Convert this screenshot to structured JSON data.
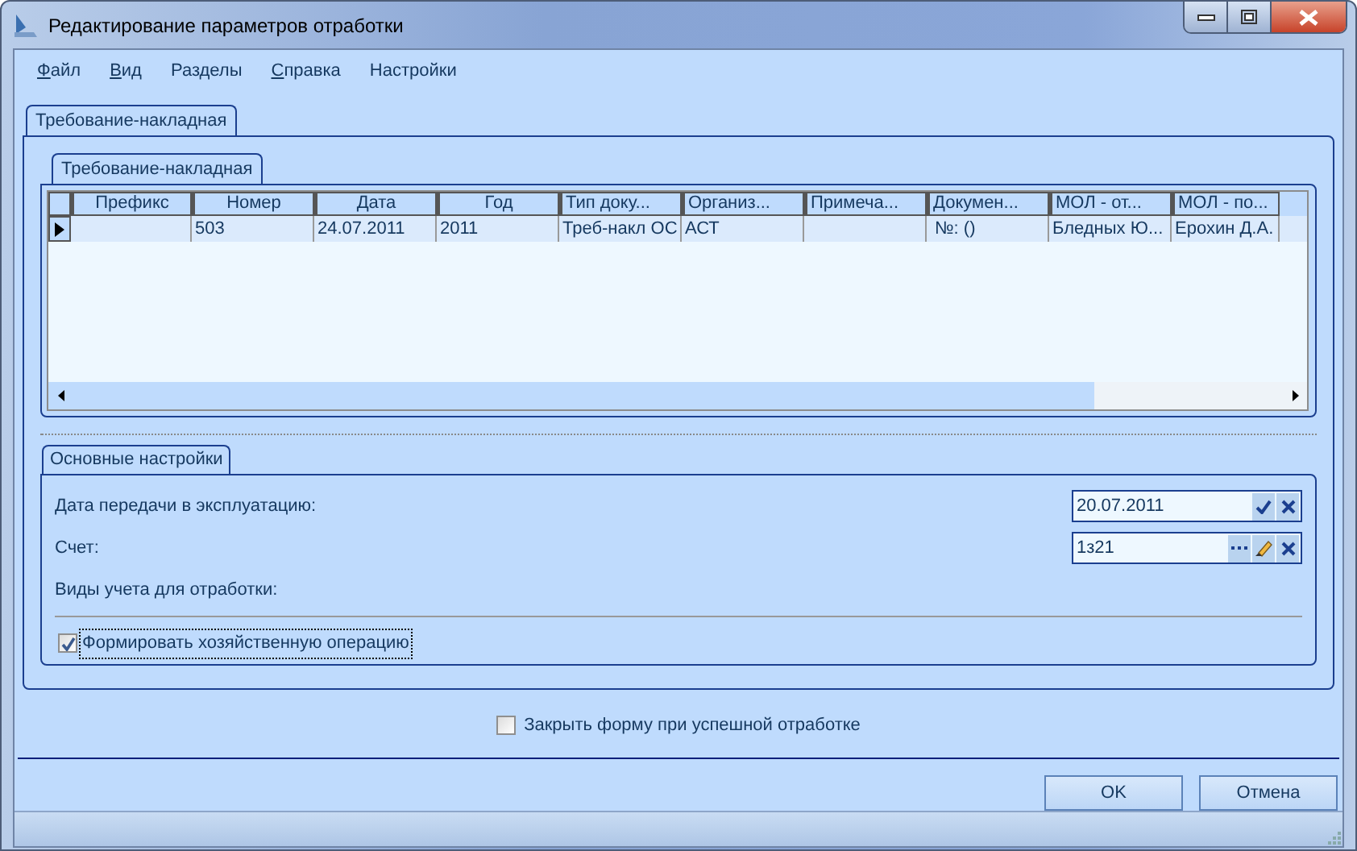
{
  "window": {
    "title": "Редактирование параметров отработки"
  },
  "menu": [
    {
      "label": "Файл",
      "mnemonic": true
    },
    {
      "label": "Вид",
      "mnemonic": true
    },
    {
      "label": "Разделы",
      "mnemonic": false
    },
    {
      "label": "Справка",
      "mnemonic": true
    },
    {
      "label": "Настройки",
      "mnemonic": false
    }
  ],
  "outer_tab": {
    "label": "Требование-накладная",
    "selected": true
  },
  "inner_tab": {
    "label": "Требование-накладная",
    "selected": true
  },
  "table": {
    "columns": [
      "Префикс",
      "Номер",
      "Дата",
      "Год",
      "Тип доку...",
      "Организ...",
      "Примеча...",
      "Докумен...",
      "МОЛ - от...",
      "МОЛ - по..."
    ],
    "rows": [
      {
        "current": true,
        "cells": [
          "",
          "503",
          "24.07.2011",
          "2011",
          "Треб-накл ОС",
          "АСТ",
          "",
          "№: ()",
          "Бледных Ю...",
          "Ерохин Д.А."
        ]
      }
    ]
  },
  "settings": {
    "title": "Основные настройки",
    "fields": [
      {
        "label": "Дата передачи в эксплуатацию:",
        "kind": "date",
        "value": "20.07.2011"
      },
      {
        "label": "Счет:",
        "kind": "lookup",
        "value": "1з21"
      },
      {
        "label": "Виды учета для отработки:",
        "kind": "none"
      }
    ],
    "option": {
      "label": "Формировать хозяйственную операцию",
      "checked": true,
      "focused": true
    }
  },
  "close_option": {
    "label": "Закрыть форму при успешной отработке",
    "checked": false
  },
  "buttons": [
    "OK",
    "Отмена"
  ]
}
